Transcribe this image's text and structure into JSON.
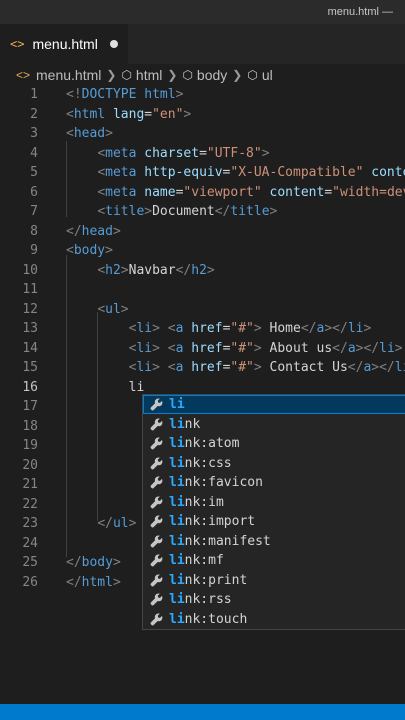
{
  "window": {
    "title": "menu.html —"
  },
  "tab": {
    "label": "menu.html",
    "icon": "<>"
  },
  "breadcrumb": [
    {
      "label": "menu.html",
      "icon": "<>"
    },
    {
      "label": "html",
      "icon": "cube-icon"
    },
    {
      "label": "body",
      "icon": "cube-icon"
    },
    {
      "label": "ul",
      "icon": "cube-icon"
    }
  ],
  "editor": {
    "active_line": 16,
    "lines": [
      {
        "n": "1",
        "tokens": [
          [
            "b",
            "<!"
          ],
          [
            "t",
            "DOCTYPE"
          ],
          [
            "dt",
            " html"
          ],
          [
            "b",
            ">"
          ]
        ]
      },
      {
        "n": "2",
        "tokens": [
          [
            "b",
            "<"
          ],
          [
            "t",
            "html"
          ],
          [
            "a",
            " lang"
          ],
          [
            "txt",
            "="
          ],
          [
            "s",
            "\"en\""
          ],
          [
            "b",
            ">"
          ]
        ]
      },
      {
        "n": "3",
        "tokens": [
          [
            "b",
            "<"
          ],
          [
            "t",
            "head"
          ],
          [
            "b",
            ">"
          ]
        ]
      },
      {
        "n": "4",
        "tokens": [
          [
            "txt",
            "    "
          ],
          [
            "b",
            "<"
          ],
          [
            "t",
            "meta"
          ],
          [
            "a",
            " charset"
          ],
          [
            "txt",
            "="
          ],
          [
            "s",
            "\"UTF-8\""
          ],
          [
            "b",
            ">"
          ]
        ]
      },
      {
        "n": "5",
        "tokens": [
          [
            "txt",
            "    "
          ],
          [
            "b",
            "<"
          ],
          [
            "t",
            "meta"
          ],
          [
            "a",
            " http-equiv"
          ],
          [
            "txt",
            "="
          ],
          [
            "s",
            "\"X-UA-Compatible\""
          ],
          [
            "a",
            " conte"
          ]
        ]
      },
      {
        "n": "6",
        "tokens": [
          [
            "txt",
            "    "
          ],
          [
            "b",
            "<"
          ],
          [
            "t",
            "meta"
          ],
          [
            "a",
            " name"
          ],
          [
            "txt",
            "="
          ],
          [
            "s",
            "\"viewport\""
          ],
          [
            "a",
            " content"
          ],
          [
            "txt",
            "="
          ],
          [
            "s",
            "\"width=dev"
          ]
        ]
      },
      {
        "n": "7",
        "tokens": [
          [
            "txt",
            "    "
          ],
          [
            "b",
            "<"
          ],
          [
            "t",
            "title"
          ],
          [
            "b",
            ">"
          ],
          [
            "txt",
            "Document"
          ],
          [
            "b",
            "</"
          ],
          [
            "t",
            "title"
          ],
          [
            "b",
            ">"
          ]
        ]
      },
      {
        "n": "8",
        "tokens": [
          [
            "b",
            "</"
          ],
          [
            "t",
            "head"
          ],
          [
            "b",
            ">"
          ]
        ]
      },
      {
        "n": "9",
        "tokens": [
          [
            "b",
            "<"
          ],
          [
            "t",
            "body"
          ],
          [
            "b",
            ">"
          ]
        ]
      },
      {
        "n": "10",
        "tokens": [
          [
            "txt",
            "    "
          ],
          [
            "b",
            "<"
          ],
          [
            "t",
            "h2"
          ],
          [
            "b",
            ">"
          ],
          [
            "txt",
            "Navbar"
          ],
          [
            "b",
            "</"
          ],
          [
            "t",
            "h2"
          ],
          [
            "b",
            ">"
          ]
        ]
      },
      {
        "n": "11",
        "tokens": []
      },
      {
        "n": "12",
        "tokens": [
          [
            "txt",
            "    "
          ],
          [
            "b",
            "<"
          ],
          [
            "t",
            "ul"
          ],
          [
            "b",
            ">"
          ]
        ]
      },
      {
        "n": "13",
        "tokens": [
          [
            "txt",
            "        "
          ],
          [
            "b",
            "<"
          ],
          [
            "t",
            "li"
          ],
          [
            "b",
            ">"
          ],
          [
            "txt",
            " "
          ],
          [
            "b",
            "<"
          ],
          [
            "t",
            "a"
          ],
          [
            "a",
            " href"
          ],
          [
            "txt",
            "="
          ],
          [
            "s",
            "\"#\""
          ],
          [
            "b",
            ">"
          ],
          [
            "txt",
            " Home"
          ],
          [
            "b",
            "</"
          ],
          [
            "t",
            "a"
          ],
          [
            "b",
            "></"
          ],
          [
            "t",
            "li"
          ],
          [
            "b",
            ">"
          ]
        ]
      },
      {
        "n": "14",
        "tokens": [
          [
            "txt",
            "        "
          ],
          [
            "b",
            "<"
          ],
          [
            "t",
            "li"
          ],
          [
            "b",
            ">"
          ],
          [
            "txt",
            " "
          ],
          [
            "b",
            "<"
          ],
          [
            "t",
            "a"
          ],
          [
            "a",
            " href"
          ],
          [
            "txt",
            "="
          ],
          [
            "s",
            "\"#\""
          ],
          [
            "b",
            ">"
          ],
          [
            "txt",
            " About us"
          ],
          [
            "b",
            "</"
          ],
          [
            "t",
            "a"
          ],
          [
            "b",
            "></"
          ],
          [
            "t",
            "li"
          ],
          [
            "b",
            ">"
          ]
        ]
      },
      {
        "n": "15",
        "tokens": [
          [
            "txt",
            "        "
          ],
          [
            "b",
            "<"
          ],
          [
            "t",
            "li"
          ],
          [
            "b",
            ">"
          ],
          [
            "txt",
            " "
          ],
          [
            "b",
            "<"
          ],
          [
            "t",
            "a"
          ],
          [
            "a",
            " href"
          ],
          [
            "txt",
            "="
          ],
          [
            "s",
            "\"#\""
          ],
          [
            "b",
            ">"
          ],
          [
            "txt",
            " Contact Us"
          ],
          [
            "b",
            "</"
          ],
          [
            "t",
            "a"
          ],
          [
            "b",
            "></"
          ],
          [
            "t",
            "li"
          ]
        ]
      },
      {
        "n": "16",
        "tokens": [
          [
            "txt",
            "        li"
          ]
        ]
      },
      {
        "n": "17",
        "tokens": []
      },
      {
        "n": "18",
        "tokens": []
      },
      {
        "n": "19",
        "tokens": []
      },
      {
        "n": "20",
        "tokens": []
      },
      {
        "n": "21",
        "tokens": []
      },
      {
        "n": "22",
        "tokens": []
      },
      {
        "n": "23",
        "tokens": [
          [
            "txt",
            "    "
          ],
          [
            "b",
            "</"
          ],
          [
            "t",
            "ul"
          ],
          [
            "b",
            ">"
          ]
        ]
      },
      {
        "n": "24",
        "tokens": []
      },
      {
        "n": "25",
        "tokens": [
          [
            "b",
            "</"
          ],
          [
            "t",
            "body"
          ],
          [
            "b",
            ">"
          ]
        ]
      },
      {
        "n": "26",
        "tokens": [
          [
            "b",
            "</"
          ],
          [
            "t",
            "html"
          ],
          [
            "b",
            ">"
          ]
        ]
      }
    ]
  },
  "suggestions": {
    "icon": "wrench-icon",
    "match": "li",
    "selected_index": 0,
    "items": [
      {
        "match": "li",
        "rest": ""
      },
      {
        "match": "li",
        "rest": "nk"
      },
      {
        "match": "li",
        "rest": "nk:atom"
      },
      {
        "match": "li",
        "rest": "nk:css"
      },
      {
        "match": "li",
        "rest": "nk:favicon"
      },
      {
        "match": "li",
        "rest": "nk:im"
      },
      {
        "match": "li",
        "rest": "nk:import"
      },
      {
        "match": "li",
        "rest": "nk:manifest"
      },
      {
        "match": "li",
        "rest": "nk:mf"
      },
      {
        "match": "li",
        "rest": "nk:print"
      },
      {
        "match": "li",
        "rest": "nk:rss"
      },
      {
        "match": "li",
        "rest": "nk:touch"
      }
    ]
  },
  "colors": {
    "accent": "#007acc",
    "tag": "#569cd6",
    "attribute": "#9cdcfe",
    "string": "#ce9178",
    "match_highlight": "#2aaaff"
  }
}
